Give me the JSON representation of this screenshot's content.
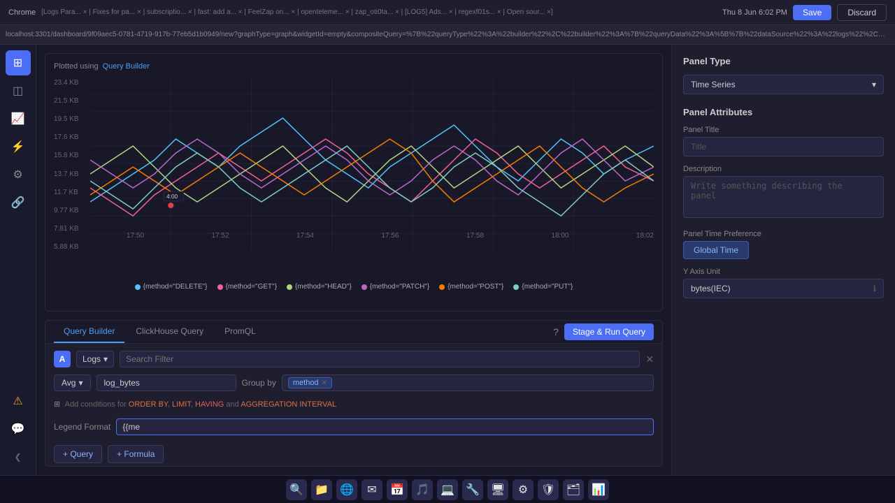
{
  "topbar": {
    "browser": "Chrome",
    "time": "Thu 8 Jun 6:02 PM",
    "url": "localhost:3301/dashboard/9f09aec5-0781-4719-917b-77eb5d1b0949/new?graphType=graph&widgetId=empty&compositeQuery=%7B%22queryType%22%3A%22builder%22%2C%22builder%22%3A%7B%22queryData%22%3A%5B%7B%22dataSource%22%3A%22logs%22%2C%22queryName%22%3A%22A%22%2C%22aggregateOperator%22%3A%22avg%22%2C%22aggregate...",
    "save_label": "Save",
    "discard_label": "Discard"
  },
  "chart": {
    "plotted_using": "Plotted using",
    "query_builder_link": "Query Builder",
    "y_axis": [
      "23.4 KB",
      "21.5 KB",
      "19.5 KB",
      "17.6 KB",
      "15.8 KB",
      "13.7 KB",
      "11.7 KB",
      "9.77 KB",
      "7.81 KB",
      "5.88 KB"
    ],
    "x_axis": [
      "17:50",
      "17:52",
      "17:54",
      "17:56",
      "17:58",
      "18:00",
      "18:02"
    ],
    "tooltip_time": "4:00",
    "legend": [
      {
        "label": "{method=\"DELETE\"}",
        "color": "#4fc3f7"
      },
      {
        "label": "{method=\"GET\"}",
        "color": "#f06292"
      },
      {
        "label": "{method=\"HEAD\"}",
        "color": "#aed581"
      },
      {
        "label": "{method=\"PATCH\"}",
        "color": "#ba68c8"
      },
      {
        "label": "{method=\"POST\"}",
        "color": "#f57c00"
      },
      {
        "label": "{method=\"PUT\"}",
        "color": "#80cbc4"
      }
    ]
  },
  "query_builder": {
    "tabs": [
      {
        "label": "Query Builder",
        "active": true
      },
      {
        "label": "ClickHouse Query",
        "active": false
      },
      {
        "label": "PromQL",
        "active": false
      }
    ],
    "help_icon": "?",
    "stage_run_label": "Stage & Run Query",
    "query_label": "A",
    "datasource": "Logs",
    "search_placeholder": "Search Filter",
    "aggregation": "Avg",
    "field": "log_bytes",
    "group_by_label": "Group by",
    "group_by_tag": "method",
    "conditions_prefix": "Add conditions for",
    "conditions_links": [
      "ORDER BY",
      "LIMIT",
      "HAVING",
      "AGGREGATION INTERVAL"
    ],
    "conditions_and": "and",
    "legend_format_label": "Legend Format",
    "legend_format_value": "{{me",
    "add_query_label": "+ Query",
    "add_formula_label": "+ Formula"
  },
  "right_panel": {
    "panel_type_label": "Panel Type",
    "panel_type_value": "Time Series",
    "panel_attributes_label": "Panel Attributes",
    "panel_title_label": "Panel Title",
    "panel_title_placeholder": "Title",
    "description_label": "Description",
    "description_placeholder": "Write something describing the  panel",
    "time_pref_label": "Panel Time Preference",
    "time_pref_value": "Global Time",
    "y_axis_unit_label": "Y Axis Unit",
    "y_axis_unit_value": "bytes(IEC)",
    "info_icon": "ℹ"
  },
  "sidebar": {
    "items": [
      {
        "icon": "⊞",
        "label": "dashboard",
        "active": true
      },
      {
        "icon": "◫",
        "label": "explore"
      },
      {
        "icon": "⚡",
        "label": "alerts"
      },
      {
        "icon": "⚙",
        "label": "settings"
      },
      {
        "icon": "🔗",
        "label": "integrations"
      }
    ],
    "bottom": [
      {
        "icon": "⚠",
        "label": "warning"
      },
      {
        "icon": "💬",
        "label": "slack"
      }
    ],
    "collapse_icon": "❮"
  },
  "dock": {
    "icons": [
      "🔍",
      "📁",
      "🌐",
      "✉",
      "📅",
      "🎵",
      "💻",
      "🔧",
      "🖥",
      "⚙",
      "🛡",
      "🗂",
      "📊"
    ]
  }
}
